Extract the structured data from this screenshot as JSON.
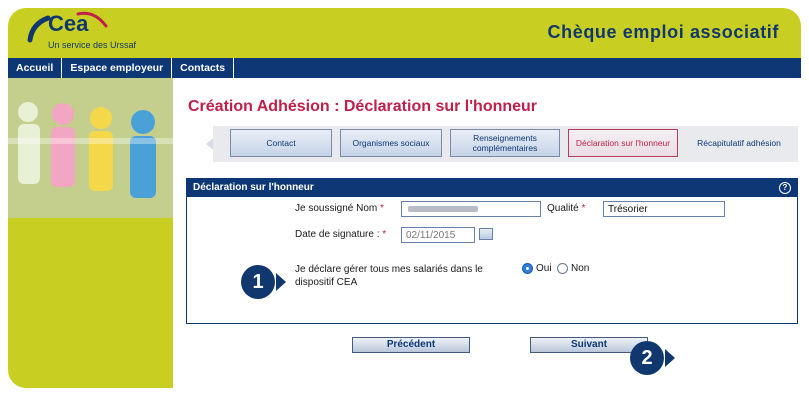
{
  "header": {
    "logo_text": "Cea",
    "logo_sub": "Un service des Urssaf",
    "app_title": "Chèque emploi associatif"
  },
  "nav": {
    "items": [
      {
        "label": "Accueil"
      },
      {
        "label": "Espace employeur"
      },
      {
        "label": "Contacts"
      }
    ]
  },
  "main": {
    "title": "Création Adhésion : Déclaration sur l'honneur",
    "tabs": [
      {
        "label": "Contact",
        "state": "normal"
      },
      {
        "label": "Organismes sociaux",
        "state": "normal"
      },
      {
        "label": "Renseignements complémentaires",
        "state": "normal"
      },
      {
        "label": "Déclaration sur l'honneur",
        "state": "active"
      },
      {
        "label": "Récapitulatif adhésion",
        "state": "plain"
      }
    ]
  },
  "panel": {
    "title": "Déclaration sur l'honneur",
    "help_icon": "question-mark-icon",
    "nom_label": "Je soussigné Nom",
    "qualite_label": "Qualité",
    "qualite_value": "Trésorier",
    "date_label": "Date de signature :",
    "date_value": "02/11/2015",
    "declare_label_line1": "Je déclare gérer tous mes salariés dans le",
    "declare_label_line2": "dispositif CEA",
    "radio_oui": "Oui",
    "radio_non": "Non",
    "selected": "Oui",
    "required_mark": "*"
  },
  "buttons": {
    "previous": "Précédent",
    "next": "Suivant"
  },
  "callouts": {
    "one": "1",
    "two": "2"
  },
  "colors": {
    "brand_lime": "#c9cf22",
    "brand_navy": "#0d3775",
    "accent_red": "#c01f4a"
  }
}
